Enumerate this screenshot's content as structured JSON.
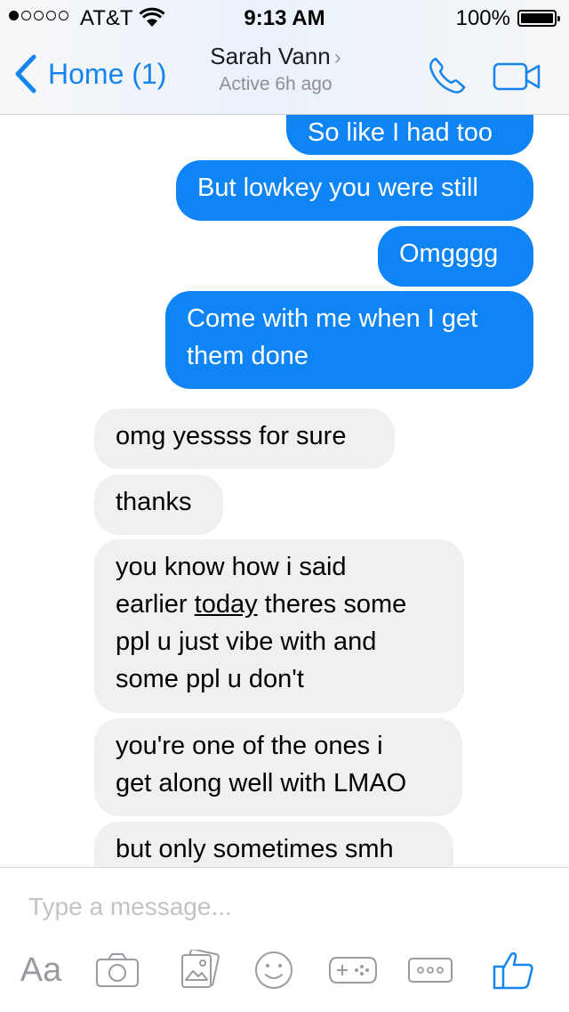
{
  "status_bar": {
    "carrier": "AT&T",
    "time": "9:13 AM",
    "battery": "100%"
  },
  "nav": {
    "back_label": "Home (1)",
    "contact_name": "Sarah Vann",
    "contact_status": "Active 6h ago"
  },
  "messages": [
    {
      "from": "me",
      "text": "So like I had too"
    },
    {
      "from": "me",
      "text": "But lowkey you were still"
    },
    {
      "from": "me",
      "text": "Omgggg"
    },
    {
      "from": "me",
      "line1": "Come with me when I get",
      "line2": "them done"
    },
    {
      "from": "them",
      "text": "omg yessss for sure"
    },
    {
      "from": "them",
      "text": "thanks"
    },
    {
      "from": "them",
      "line1": "you know how i said",
      "line2a": "earlier ",
      "line2b": "today",
      "line2c": " theres some",
      "line3": "ppl u just vibe with and",
      "line4": "some ppl u don't"
    },
    {
      "from": "them",
      "line1": "you're one of the ones i",
      "line2": "get along well with LMAO"
    },
    {
      "from": "them",
      "text": "but only sometimes smh"
    }
  ],
  "composer": {
    "placeholder": "Type a message...",
    "text_tool_label": "Aa"
  },
  "colors": {
    "accent": "#1584ed",
    "outgoing_bubble": "#0f84f4",
    "incoming_bubble": "#f0f0f0",
    "icon_gray": "#9a9aa0"
  }
}
